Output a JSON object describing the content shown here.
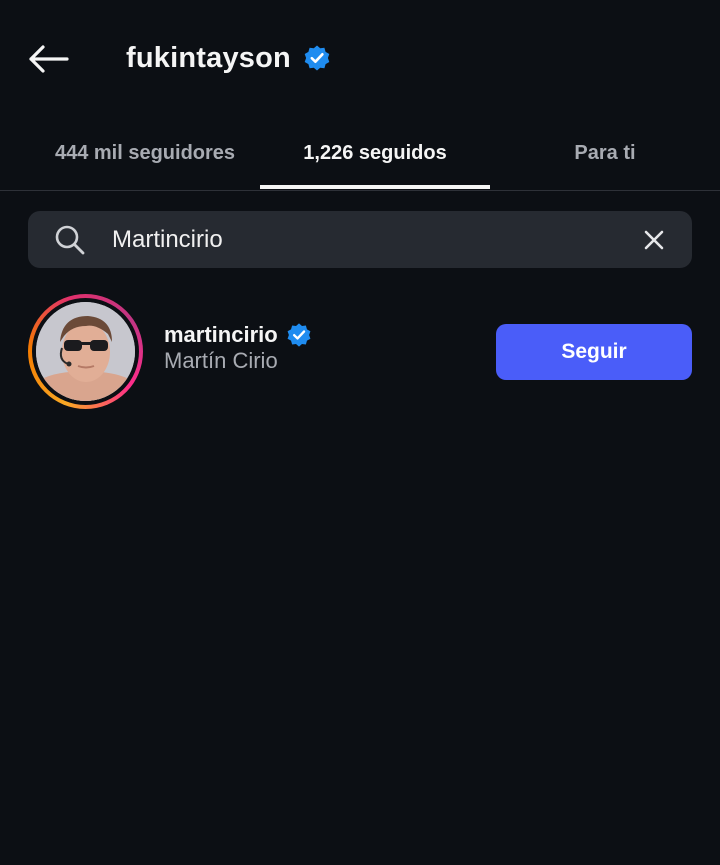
{
  "header": {
    "title": "fukintayson",
    "back_icon": "arrow-left-icon",
    "verified_icon": "verified-badge-icon"
  },
  "tabs": [
    {
      "label": "444 mil seguidores",
      "active": false
    },
    {
      "label": "1,226 seguidos",
      "active": true
    },
    {
      "label": "Para ti",
      "active": false
    }
  ],
  "search": {
    "value": "Martincirio",
    "icon": "search-icon",
    "clear_icon": "close-icon"
  },
  "results": [
    {
      "username": "martincirio",
      "full_name": "Martín Cirio",
      "verified": true,
      "follow_label": "Seguir"
    }
  ],
  "colors": {
    "background": "#0c0f14",
    "search_bg": "#262a31",
    "primary_button": "#4a5df9",
    "verified": "#1f8cf0",
    "muted_text": "#a8abb2"
  }
}
